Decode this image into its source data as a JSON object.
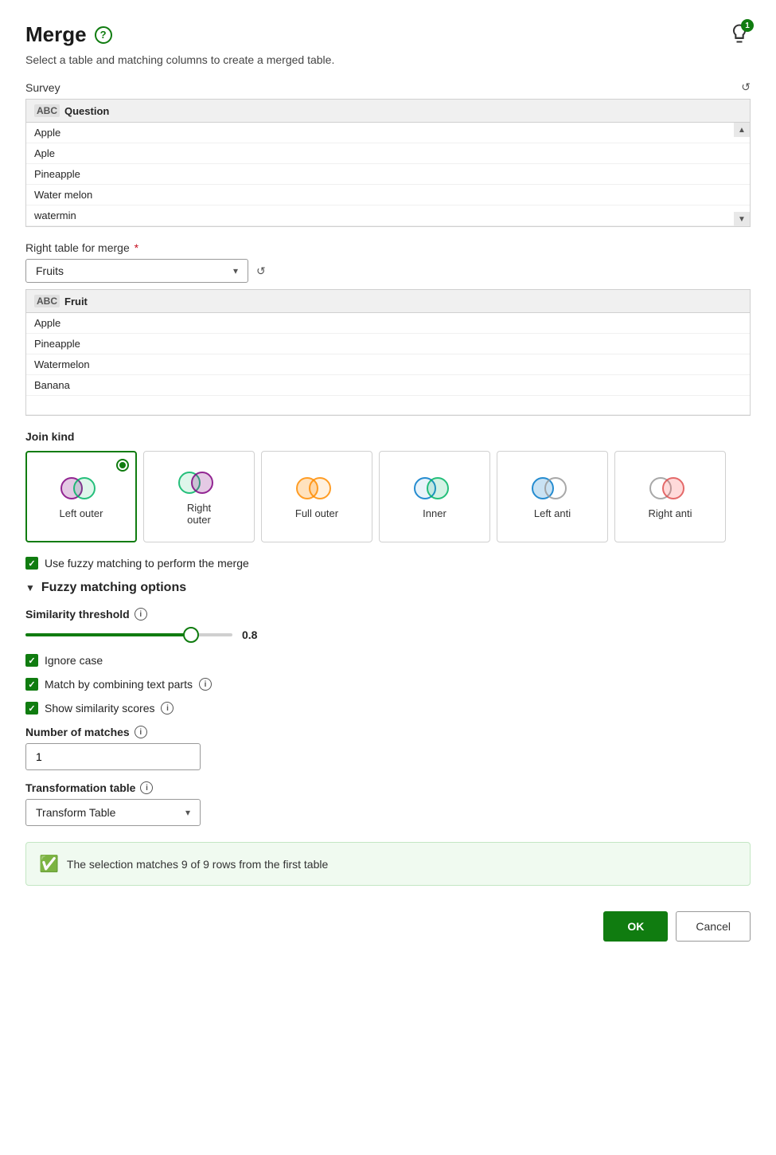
{
  "title": "Merge",
  "subtitle": "Select a table and matching columns to create a merged table.",
  "lightbulb_badge": "1",
  "left_table": {
    "label": "Survey",
    "column_header": "Question",
    "rows": [
      "Apple",
      "Aple",
      "Pineapple",
      "Water melon",
      "watermin"
    ]
  },
  "right_table": {
    "label": "Right table for merge",
    "required": true,
    "selected": "Fruits",
    "column_header": "Fruit",
    "rows": [
      "Apple",
      "Pineapple",
      "Watermelon",
      "Banana"
    ]
  },
  "join_kind": {
    "label": "Join kind",
    "options": [
      {
        "id": "left_outer",
        "label": "Left outer",
        "selected": true
      },
      {
        "id": "right_outer",
        "label": "Right outer",
        "selected": false
      },
      {
        "id": "full_outer",
        "label": "Full outer",
        "selected": false
      },
      {
        "id": "inner",
        "label": "Inner",
        "selected": false
      },
      {
        "id": "left_anti",
        "label": "Left anti",
        "selected": false
      },
      {
        "id": "right_anti",
        "label": "Right anti",
        "selected": false
      }
    ]
  },
  "fuzzy_check": {
    "label": "Use fuzzy matching to perform the merge",
    "checked": true
  },
  "fuzzy_section": {
    "title": "Fuzzy matching options",
    "threshold": {
      "label": "Similarity threshold",
      "value": "0.8",
      "percent": 80
    },
    "ignore_case": {
      "label": "Ignore case",
      "checked": true
    },
    "match_combining": {
      "label": "Match by combining text parts",
      "checked": true
    },
    "show_similarity": {
      "label": "Show similarity scores",
      "checked": true
    }
  },
  "num_matches": {
    "label": "Number of matches",
    "value": "1"
  },
  "transform_table": {
    "label": "Transformation table",
    "selected": "Transform Table"
  },
  "success_banner": {
    "text": "The selection matches 9 of 9 rows from the first table"
  },
  "buttons": {
    "ok": "OK",
    "cancel": "Cancel"
  }
}
